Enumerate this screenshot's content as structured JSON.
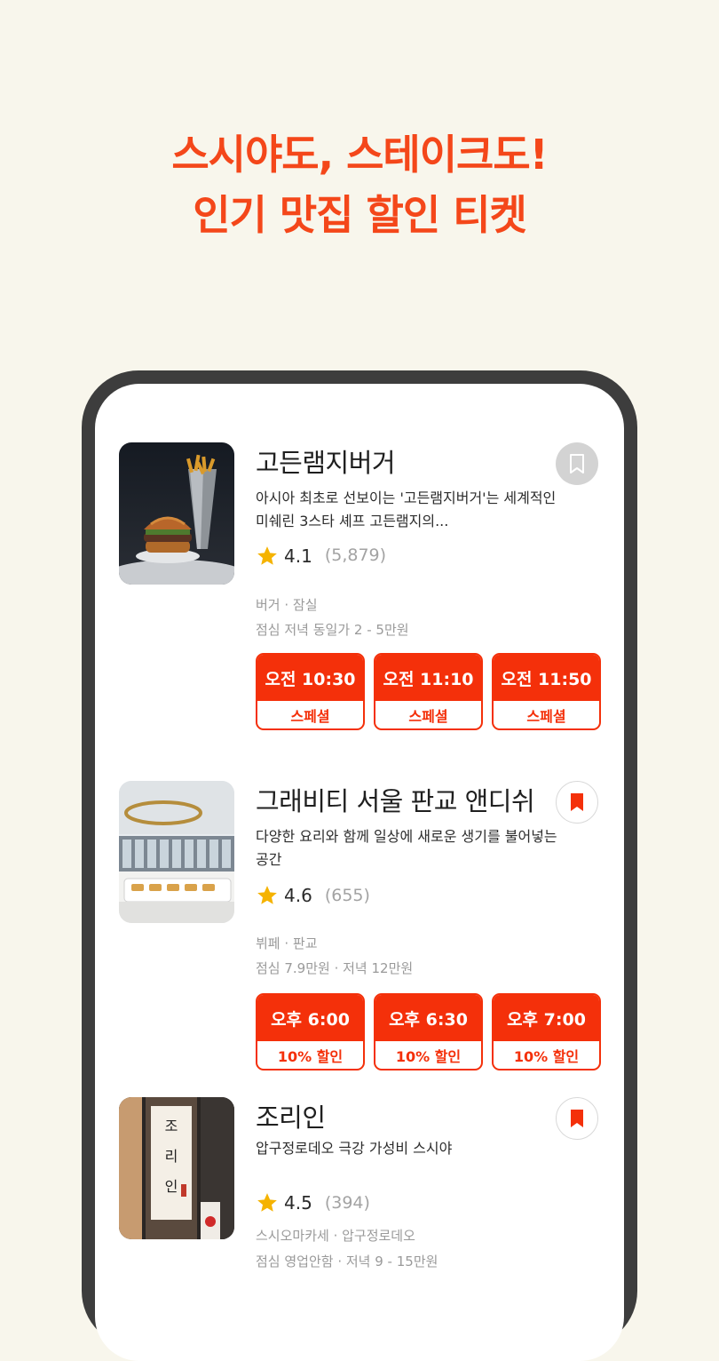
{
  "headline": {
    "line1": "스시야도, 스테이크도!",
    "line2": "인기 맛집 할인 티켓"
  },
  "colors": {
    "accent": "#f4300a",
    "headline": "#f4471a",
    "background": "#f8f6ec",
    "star": "#f5b300"
  },
  "restaurants": [
    {
      "name": "고든램지버거",
      "bookmarked": false,
      "bookmark_icon": "bookmark-outline-icon",
      "description": "아시아 최초로 선보이는 '고든램지버거'는 세계적인 미쉐린 3스타 셰프 고든램지의...",
      "rating": "4.1",
      "review_count": "(5,879)",
      "category": "버거 · 잠실",
      "price": "점심 저녁 동일가 2 - 5만원",
      "slots": [
        {
          "time": "오전 10:30",
          "tag": "스페셜"
        },
        {
          "time": "오전 11:10",
          "tag": "스페셜"
        },
        {
          "time": "오전 11:50",
          "tag": "스페셜"
        }
      ]
    },
    {
      "name": "그래비티 서울 판교 앤디쉬",
      "bookmarked": true,
      "bookmark_icon": "bookmark-filled-icon",
      "description": "다양한 요리와 함께 일상에 새로운 생기를 불어넣는 공간",
      "rating": "4.6",
      "review_count": "(655)",
      "category": "뷔페 · 판교",
      "price": "점심 7.9만원 · 저녁 12만원",
      "slots": [
        {
          "time": "오후 6:00",
          "tag": "10% 할인"
        },
        {
          "time": "오후 6:30",
          "tag": "10% 할인"
        },
        {
          "time": "오후 7:00",
          "tag": "10% 할인"
        }
      ]
    },
    {
      "name": "조리인",
      "bookmarked": true,
      "bookmark_icon": "bookmark-filled-icon",
      "description": "압구정로데오 극강 가성비 스시야",
      "rating": "4.5",
      "review_count": "(394)",
      "category": "스시오마카세 · 압구정로데오",
      "price": "점심 영업안함 · 저녁 9 - 15만원",
      "sign_text": "조리인"
    }
  ]
}
